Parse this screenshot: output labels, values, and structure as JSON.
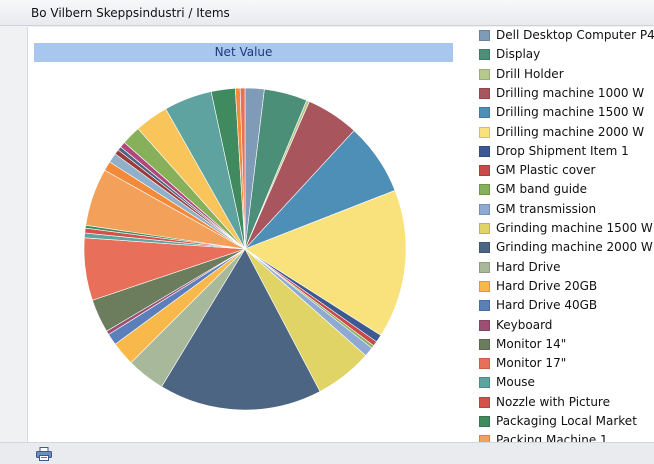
{
  "window": {
    "title": "Bo Vilbern Skeppsindustri / Items"
  },
  "toolbar": {
    "print_icon": "printer-icon"
  },
  "chart_data": {
    "type": "pie",
    "title": "Net Value",
    "legend_position": "right",
    "slices": [
      {
        "label": "Dell Desktop Computer P4",
        "value": 2.0,
        "color": "#7f9bb8"
      },
      {
        "label": "Display",
        "value": 4.5,
        "color": "#4c8f78"
      },
      {
        "label": "Drill Holder",
        "value": 0.3,
        "color": "#b6c98c"
      },
      {
        "label": "Drilling machine 1000 W",
        "value": 5.5,
        "color": "#a9555d"
      },
      {
        "label": "Drilling machine 1500 W",
        "value": 7.5,
        "color": "#4e8fb8"
      },
      {
        "label": "Drilling machine 2000 W",
        "value": 15.5,
        "color": "#f9e27c"
      },
      {
        "label": "Drop Shipment Item 1",
        "value": 0.8,
        "color": "#3c5a91"
      },
      {
        "label": "GM Plastic cover",
        "value": 0.5,
        "color": "#c84a4a"
      },
      {
        "label": "GM band guide",
        "value": 0.3,
        "color": "#86b05a"
      },
      {
        "label": "GM transmission",
        "value": 1.0,
        "color": "#8fa9d4"
      },
      {
        "label": "Grinding machine 1500 W",
        "value": 6.0,
        "color": "#e1d467"
      },
      {
        "label": "Grinding machine 2000 W",
        "value": 17.0,
        "color": "#4b6583"
      },
      {
        "label": "Hard Drive",
        "value": 4.0,
        "color": "#a8b89b"
      },
      {
        "label": "Hard Drive 20GB",
        "value": 2.5,
        "color": "#f8b84a"
      },
      {
        "label": "Hard Drive 40GB",
        "value": 1.2,
        "color": "#5b7fba"
      },
      {
        "label": "Keyboard",
        "value": 0.4,
        "color": "#9a4f73"
      },
      {
        "label": "Monitor 14\"",
        "value": 3.5,
        "color": "#6b7d5c"
      },
      {
        "label": "Monitor 17\"",
        "value": 6.5,
        "color": "#e8705a"
      },
      {
        "label": "Mouse",
        "value": 0.5,
        "color": "#5fa3a0"
      },
      {
        "label": "Nozzle with Picture",
        "value": 0.5,
        "color": "#d6504a"
      },
      {
        "label": "Packaging Local Market",
        "value": 0.3,
        "color": "#3f8a5e"
      },
      {
        "label": "Packing Machine 1",
        "value": 6.0,
        "color": "#f2a05a"
      },
      {
        "label": "",
        "value": 1.0,
        "color": "#f28a3a"
      },
      {
        "label": "",
        "value": 1.0,
        "color": "#8fb0c8"
      },
      {
        "label": "",
        "value": 0.5,
        "color": "#9b3b3b"
      },
      {
        "label": "",
        "value": 0.4,
        "color": "#4b6583"
      },
      {
        "label": "",
        "value": 0.6,
        "color": "#b1477a"
      },
      {
        "label": "",
        "value": 2.0,
        "color": "#86b05a"
      },
      {
        "label": "",
        "value": 3.5,
        "color": "#f9c45a"
      },
      {
        "label": "",
        "value": 5.0,
        "color": "#5fa3a0"
      },
      {
        "label": "",
        "value": 2.5,
        "color": "#3f8a5e"
      },
      {
        "label": "",
        "value": 0.5,
        "color": "#f28a3a"
      },
      {
        "label": "",
        "value": 0.5,
        "color": "#e8705a"
      }
    ]
  }
}
